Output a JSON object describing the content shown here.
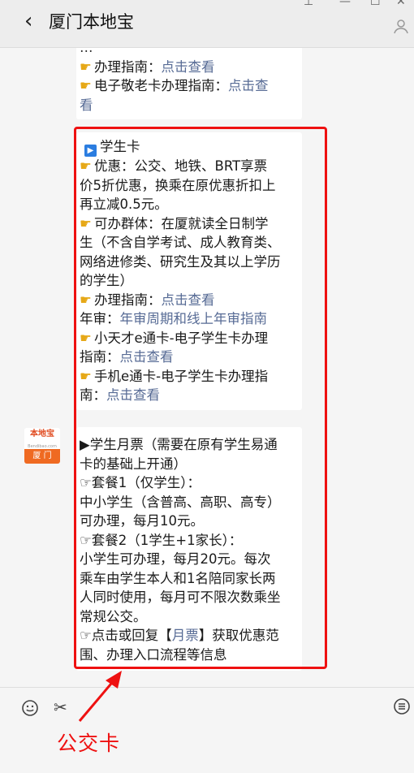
{
  "header": {
    "back": "‹",
    "title": "厦门本地宝",
    "person_icon": "person-icon"
  },
  "bubble1": {
    "partial": "…",
    "guide_prefix": "办理指南：",
    "guide_link": "点击查看",
    "ecard_prefix": "电子敬老卡办理指南：",
    "ecard_link1": "点击查",
    "ecard_link2": "看"
  },
  "bubble2": {
    "heading": "学生卡",
    "l1": "优惠：公交、地铁、BRT享票",
    "l2": "价5折优惠，换乘在原优惠折扣上",
    "l3": "再立减0.5元。",
    "l4": "可办群体：在厦就读全日制学",
    "l5": "生（不含自学考试、成人教育类、",
    "l6": "网络进修类、研究生及其以上学历",
    "l7": "的学生）",
    "guide_prefix": "办理指南：",
    "guide_link": "点击查看",
    "audit_prefix": "年审：",
    "audit_link": "年审周期和线上年审指南",
    "l10": "小天才e通卡-电子学生卡办理",
    "l11_prefix": "指南：",
    "l11_link": "点击查看",
    "l12": "手机e通卡-电子学生卡办理指",
    "l13_prefix": "南：",
    "l13_link": "点击查看"
  },
  "avatar": {
    "top": "本地宝",
    "sub": "Bendibao.com",
    "bottom": "厦 门"
  },
  "bubble3": {
    "l1": "▶学生月票（需要在原有学生易通",
    "l2": "卡的基础上开通）",
    "l3": "☞套餐1（仅学生）：",
    "l4": "中小学生（含普高、高职、高专）",
    "l5": "可办理，每月10元。",
    "l6": "☞套餐2（1学生+1家长）：",
    "l7": "小学生可办理，每月20元。每次",
    "l8": "乘车由学生本人和1名陪同家长两",
    "l9": "人同时使用，每月可不限次数乘坐",
    "l10": "常规公交。",
    "l11_prefix": "☞点击或回复【",
    "l11_link": "月票",
    "l11_suffix": "】获取优惠范",
    "l12": "围、办理入口流程等信息"
  },
  "annotation": "公交卡",
  "colors": {
    "link": "#576b95",
    "red": "#ee1111",
    "icon": "#e6a817"
  }
}
